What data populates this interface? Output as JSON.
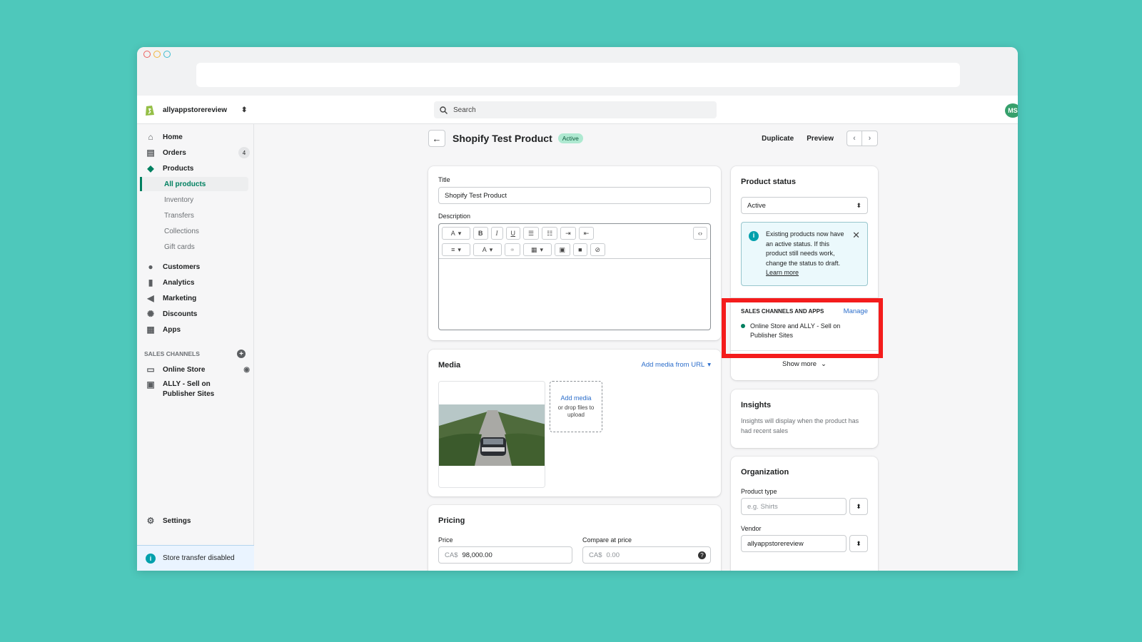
{
  "browser": {
    "url": ""
  },
  "topbar": {
    "store_name": "allyappstorereview",
    "search_placeholder": "Search",
    "avatar_initials": "MS"
  },
  "sidebar": {
    "items": [
      {
        "label": "Home",
        "icon": "home-icon"
      },
      {
        "label": "Orders",
        "icon": "orders-icon",
        "badge": "4"
      },
      {
        "label": "Products",
        "icon": "tag-icon"
      }
    ],
    "product_subitems": [
      "All products",
      "Inventory",
      "Transfers",
      "Collections",
      "Gift cards"
    ],
    "more_items": [
      {
        "label": "Customers",
        "icon": "person-icon"
      },
      {
        "label": "Analytics",
        "icon": "bar-chart-icon"
      },
      {
        "label": "Marketing",
        "icon": "megaphone-icon"
      },
      {
        "label": "Discounts",
        "icon": "discount-icon"
      },
      {
        "label": "Apps",
        "icon": "apps-icon"
      }
    ],
    "sales_channels_label": "SALES CHANNELS",
    "channels": [
      {
        "label": "Online Store",
        "icon": "store-icon"
      },
      {
        "label": "ALLY - Sell on Publisher Sites",
        "icon": "app-icon"
      }
    ],
    "settings_label": "Settings",
    "transfer_notice": "Store transfer disabled"
  },
  "page": {
    "title": "Shopify Test Product",
    "status_badge": "Active",
    "duplicate_label": "Duplicate",
    "preview_label": "Preview"
  },
  "details": {
    "title_label": "Title",
    "title_value": "Shopify Test Product",
    "description_label": "Description"
  },
  "media": {
    "title": "Media",
    "add_from_url": "Add media from URL",
    "add_media": "Add media",
    "drop_hint": "or drop files to upload"
  },
  "pricing": {
    "title": "Pricing",
    "price_label": "Price",
    "price_prefix": "CA$",
    "price_value": "98,000.00",
    "compare_label": "Compare at price",
    "compare_prefix": "CA$",
    "compare_value": "0.00"
  },
  "status_card": {
    "title": "Product status",
    "selected": "Active",
    "banner_text": "Existing products now have an active status. If this product still needs work, change the status to draft.",
    "learn_more": "Learn more",
    "channels_heading": "SALES CHANNELS AND APPS",
    "manage_label": "Manage",
    "channel_text": "Online Store and ALLY - Sell on Publisher Sites",
    "show_more": "Show more"
  },
  "insights": {
    "title": "Insights",
    "text": "Insights will display when the product has had recent sales"
  },
  "organization": {
    "title": "Organization",
    "product_type_label": "Product type",
    "product_type_placeholder": "e.g. Shirts",
    "vendor_label": "Vendor",
    "vendor_value": "allyappstorereview"
  },
  "colors": {
    "background": "#4ec8bb",
    "accent_green": "#008060",
    "highlight_red": "#f41c1c",
    "link_blue": "#2c6ecb"
  }
}
